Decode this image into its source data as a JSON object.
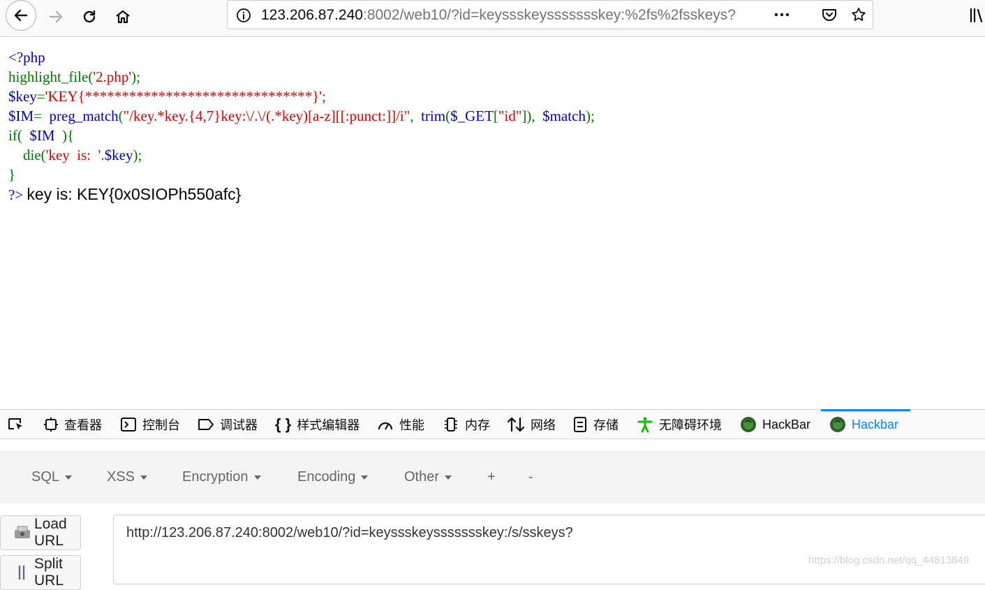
{
  "browser": {
    "url_host": "123.206.87.240",
    "url_rest": ":8002/web10/?id=keyssskeyssssssskey:%2fs%2fsskeys?"
  },
  "code": {
    "line1": "<?php",
    "line2_fn": "highlight_file",
    "line2_open": "(",
    "line2_str": "'2.php'",
    "line2_close": ");",
    "line3_var": "$key",
    "line3_eq": "=",
    "line3_str": "'KEY{*******************************}'",
    "line3_end": ";",
    "line4_var": "$IM",
    "line4_eq": "=  ",
    "line4_fn": "preg_match",
    "line4_open": "(",
    "line4_str": "\"/key.*key.{4,7}key:\\/.\\/(.*key)[a-z][[:punct:]]/i\"",
    "line4_sep": ",  ",
    "line4_fn2": "trim",
    "line4_open2": "(",
    "line4_get": "$_GET",
    "line4_br": "[",
    "line4_idx": "\"id\"",
    "line4_br2": "]),  ",
    "line4_match": "$match",
    "line4_end": ");",
    "line5_if": "if(  ",
    "line5_var": "$IM",
    "line5_end": "  ){",
    "line6_fn": "    die(",
    "line6_str": "'key  is:  '",
    "line6_dot": ".",
    "line6_var": "$key",
    "line6_end": ");",
    "line7": "}",
    "line8": "?>",
    "output": "key is: KEY{0x0SIOPh550afc}"
  },
  "devtools": {
    "tabs": [
      {
        "label": "查看器",
        "icon": "inspector-icon"
      },
      {
        "label": "控制台",
        "icon": "console-icon"
      },
      {
        "label": "调试器",
        "icon": "debugger-icon"
      },
      {
        "label": "样式编辑器",
        "icon": "style-editor-icon"
      },
      {
        "label": "性能",
        "icon": "performance-icon"
      },
      {
        "label": "内存",
        "icon": "memory-icon"
      },
      {
        "label": "网络",
        "icon": "network-icon"
      },
      {
        "label": "存储",
        "icon": "storage-icon"
      },
      {
        "label": "无障碍环境",
        "icon": "accessibility-icon"
      },
      {
        "label": "HackBar",
        "icon": "hackbar-icon"
      },
      {
        "label": "Hackbar",
        "icon": "hackbar-icon"
      }
    ],
    "active_color": "#0a84ff"
  },
  "hackbar": {
    "menu": [
      "SQL",
      "XSS",
      "Encryption",
      "Encoding",
      "Other",
      "+",
      "-"
    ],
    "load_url": "Load URL",
    "split_url": "Split URL",
    "url_value": "http://123.206.87.240:8002/web10/?id=keyssskeyssssssskey:/s/sskeys?"
  },
  "watermark": "https://blog.csdn.net/qq_44813849"
}
